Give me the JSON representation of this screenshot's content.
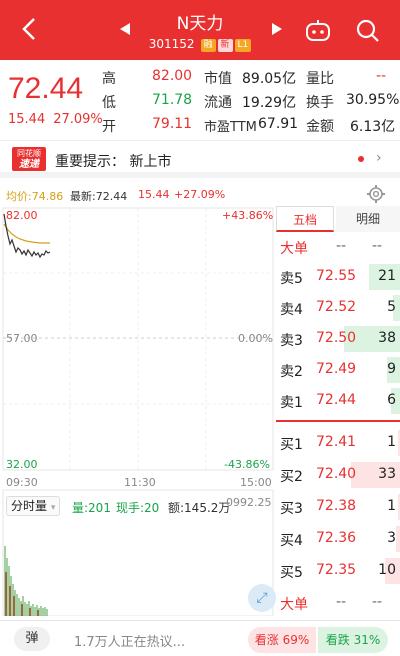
{
  "header": {
    "title": "N天力",
    "code": "301152",
    "tags": [
      "融",
      "新",
      "L1"
    ]
  },
  "quote": {
    "price": "72.44",
    "change": "15.44",
    "change_pct": "27.09%",
    "high_label": "高",
    "high": "82.00",
    "low_label": "低",
    "low": "71.78",
    "open_label": "开",
    "open": "79.11",
    "mktcap_label": "市值",
    "mktcap": "89.05亿",
    "float_label": "流通",
    "float": "19.29亿",
    "pe_label": "市盈TTM",
    "pe": "67.91",
    "volratio_label": "量比",
    "volratio": "--",
    "turnover_label": "换手",
    "turnover": "30.95%",
    "amount_label": "金额",
    "amount": "6.13亿"
  },
  "notice": {
    "logo_line1": "同花顺",
    "logo_line2": "速递",
    "text": "重要提示：  新上市"
  },
  "infobar": {
    "avg": "均价:74.86",
    "latest": "最新:72.44",
    "chg": "15.44",
    "pct": "+27.09%"
  },
  "chart_labels": {
    "top_price": "82.00",
    "top_pct": "+43.86%",
    "mid_price": "57.00",
    "mid_pct": "0.00%",
    "bot_price": "32.00",
    "bot_pct": "-43.86%",
    "t_start": "09:30",
    "t_mid": "11:30",
    "t_end": "15:00",
    "vol_select": "分时量",
    "vol": "量:201",
    "hand": "现手:20",
    "amt": "额:145.2万",
    "vol_max": "0992.25"
  },
  "tabs": {
    "level5": "五档",
    "detail": "明细"
  },
  "book": {
    "big_label": "大单",
    "big_a": "--",
    "big_b": "--",
    "sells": [
      {
        "label": "卖5",
        "price": "72.55",
        "vol": "21",
        "frac": 0.55
      },
      {
        "label": "卖4",
        "price": "72.52",
        "vol": "5",
        "frac": 0.13
      },
      {
        "label": "卖3",
        "price": "72.50",
        "vol": "38",
        "frac": 1.0
      },
      {
        "label": "卖2",
        "price": "72.49",
        "vol": "9",
        "frac": 0.24
      },
      {
        "label": "卖1",
        "price": "72.44",
        "vol": "6",
        "frac": 0.16
      }
    ],
    "buys": [
      {
        "label": "买1",
        "price": "72.41",
        "vol": "1",
        "frac": 0.03
      },
      {
        "label": "买2",
        "price": "72.40",
        "vol": "33",
        "frac": 0.87
      },
      {
        "label": "买3",
        "price": "72.38",
        "vol": "1",
        "frac": 0.03
      },
      {
        "label": "买4",
        "price": "72.36",
        "vol": "3",
        "frac": 0.08
      },
      {
        "label": "买5",
        "price": "72.35",
        "vol": "10",
        "frac": 0.26
      }
    ],
    "big_label2": "大单",
    "big2_a": "--",
    "big2_b": "--"
  },
  "footer": {
    "danmu": "弹",
    "hot": "1.7万人正在热议...",
    "up": "看涨 69%",
    "down": "看跌 31%"
  },
  "colors": {
    "red": "#e93030",
    "green": "#1aa34a",
    "avg_line": "#d4a017"
  }
}
